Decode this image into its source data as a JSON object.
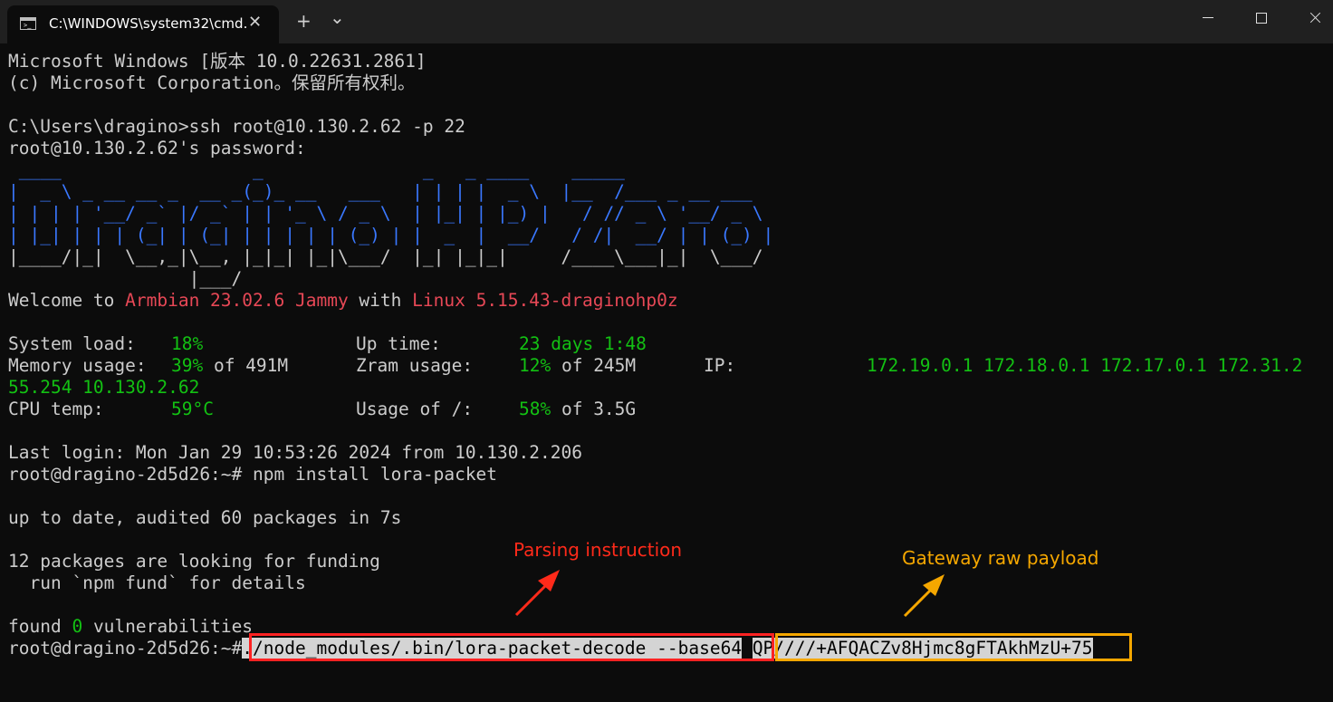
{
  "window": {
    "tab_title": "C:\\WINDOWS\\system32\\cmd.",
    "tab_close": "✕",
    "new_tab": "+",
    "dropdown": "⌄"
  },
  "terminal": {
    "header1": "Microsoft Windows [版本 10.0.22631.2861]",
    "header2": "(c) Microsoft Corporation。保留所有权利。",
    "prompt_ssh": "C:\\Users\\dragino>ssh root@10.130.2.62 -p 22",
    "password": "root@10.130.2.62's password:",
    "logo": [
      " ____                  _               _   _ ____    _____",
      "|  _ \\ _ __ __ _  __ _(_)_ __   ___   | | | |  _ \\  |__  /___ _ __ ___",
      "| | | | '__/ _` |/ _` | | '_ \\ / _ \\  | |_| | |_) |   / // _ \\ '__/ _ \\",
      "| |_| | | | (_| | (_| | | | | | (_) | |  _  |  __/   / /|  __/ | | (_) |",
      "|____/|_|  \\__,_|\\__, |_|_| |_|\\___/  |_| |_|_|     /____\\___|_|  \\___/",
      "                 |___/"
    ],
    "welcome": {
      "prefix": "Welcome to ",
      "os": "Armbian 23.02.6 Jammy",
      "mid": " with ",
      "kernel": "Linux 5.15.43-draginohp0z"
    },
    "stats": {
      "system_load_label": "System load:",
      "system_load_value": "18%",
      "up_time_label": "Up time:",
      "up_time_value": "23 days 1:48",
      "memory_label": "Memory usage:",
      "memory_value": "39%",
      "memory_rest": " of 491M",
      "zram_label": "Zram usage:",
      "zram_value": "12%",
      "zram_rest": " of 245M",
      "ip_label": "IP:",
      "ip_value_1": "172.19.0.1 172.18.0.1 172.17.0.1 172.31.2",
      "ip_value_2": "55.254 10.130.2.62",
      "cpu_label": "CPU temp:",
      "cpu_value": "59°C",
      "usage_label": "Usage of /:",
      "usage_value": "58%",
      "usage_rest": " of 3.5G"
    },
    "last_login": "Last login: Mon Jan 29 10:53:26 2024 from 10.130.2.206",
    "prompt_npm": "root@dragino-2d5d26:~# npm install lora-packet",
    "up_to_date": "up to date, audited 60 packages in 7s",
    "funding1": "12 packages are looking for funding",
    "funding2": "  run `npm fund` for details",
    "found_prefix": "found ",
    "found_count": "0",
    "found_suffix": " vulnerabilities",
    "prompt_final": "root@dragino-2d5d26:~#",
    "cmd_instruction": "./node_modules/.bin/lora-packet-decode --base64",
    "cmd_payload": "QP////+AFQACZv8Hjmc8gFTAkhMzU+75"
  },
  "annotations": {
    "parsing": "Parsing instruction",
    "payload": "Gateway raw payload",
    "red_color": "#ff2a1a",
    "orange_color": "#f5a700"
  }
}
